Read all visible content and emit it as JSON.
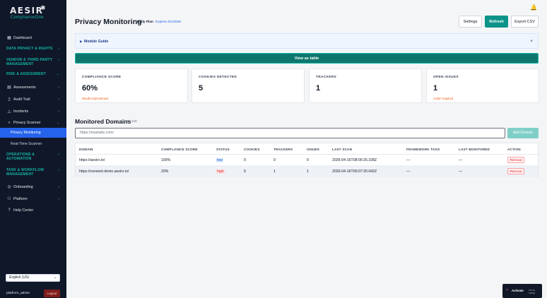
{
  "brand": {
    "name": "AESIR",
    "mark": "✱",
    "product": "ComplianceOne"
  },
  "sidebar": {
    "items": [
      {
        "type": "item",
        "label": "Dashboard",
        "icon": "grid-icon",
        "glyph": "▦",
        "chev": ""
      },
      {
        "type": "section",
        "label": "DATA PRIVACY & RIGHTS",
        "chev": "›"
      },
      {
        "type": "section",
        "label": "VENDOR & THIRD-PARTY MANAGEMENT",
        "chev": "›"
      },
      {
        "type": "section",
        "label": "RISK & ASSESSMENT",
        "chev": "⌄"
      },
      {
        "type": "item",
        "label": "Assessments",
        "icon": "clipboard-icon",
        "glyph": "▤",
        "chev": "›"
      },
      {
        "type": "item",
        "label": "Audit Trail",
        "icon": "document-icon",
        "glyph": "▯",
        "chev": "›"
      },
      {
        "type": "item",
        "label": "Incidents",
        "icon": "warning-icon",
        "glyph": "△",
        "chev": "›"
      },
      {
        "type": "item",
        "label": "Privacy Scanner",
        "icon": "search-icon",
        "glyph": "⌕",
        "chev": "⌄"
      },
      {
        "type": "sub",
        "label": "Privacy Monitoring",
        "active": true
      },
      {
        "type": "sub",
        "label": "Real-Time Scanner",
        "active": false
      },
      {
        "type": "section",
        "label": "OPERATIONS & AUTOMATION",
        "chev": "›"
      },
      {
        "type": "section",
        "label": "TASK & WORKFLOW MANAGEMENT",
        "chev": "›"
      },
      {
        "type": "item",
        "label": "Onboarding",
        "icon": "circle-icon",
        "glyph": "◎",
        "chev": "›"
      },
      {
        "type": "item",
        "label": "Platform",
        "icon": "user-icon",
        "glyph": "⚇",
        "chev": "›"
      },
      {
        "type": "item",
        "label": "Help Center",
        "icon": "help-icon",
        "glyph": "?",
        "chev": ""
      }
    ],
    "language": "English (US)",
    "username": "platform_admin",
    "logout_label": "Logout"
  },
  "header": {
    "title": "Privacy Monitoring",
    "plan": "Daily Plan",
    "expiry": "Expires 6/1/2026",
    "settings_label": "Settings",
    "refresh_label": "Refresh",
    "export_label": "Export CSV"
  },
  "guide": {
    "caret": "▶",
    "label": "Module Guide",
    "close": "×"
  },
  "view_table_label": "View as table",
  "cards": [
    {
      "label": "COMPLIANCE SCORE",
      "value": "60%",
      "note": "Needs improvement"
    },
    {
      "label": "COOKIES DETECTED",
      "value": "5",
      "note": ""
    },
    {
      "label": "TRACKERS",
      "value": "1",
      "note": ""
    },
    {
      "label": "OPEN ISSUES",
      "value": "1",
      "note": "Action required"
    }
  ],
  "domains": {
    "title": "Monitored Domains",
    "count": "2 / 100",
    "input_placeholder": "https://example.com/",
    "add_label": "Add Domain",
    "columns": [
      "DOMAIN",
      "COMPLIANCE SCORE",
      "STATUS",
      "COOKIES",
      "TRACKERS",
      "ISSUES",
      "LAST SCAN",
      "FRAMEWORK TAGS",
      "LAST MONITORED",
      "ACTION"
    ],
    "rows": [
      {
        "domain": "https://aesirx.io/",
        "score": "100%",
        "status": "low",
        "cookies": "0",
        "trackers": "0",
        "issues": "0",
        "last_scan": "2026-04-16T08:00:25.108Z",
        "tags": "—",
        "last_monitored": "—",
        "action": "Remove"
      },
      {
        "domain": "https://consent.demo.aesirx.io/",
        "score": "20%",
        "status": "high",
        "cookies": "5",
        "trackers": "1",
        "issues": "1",
        "last_scan": "2026-04-16T00:07:20.042Z",
        "tags": "—",
        "last_monitored": "—",
        "action": "Remove"
      }
    ]
  },
  "toast": {
    "close": "×",
    "label": "Activate",
    "sub": "Go to setup"
  },
  "colors": {
    "accent": "#0d9488",
    "sidebar_bg": "#0f1729",
    "active": "#2563eb",
    "danger": "#dc2626"
  }
}
